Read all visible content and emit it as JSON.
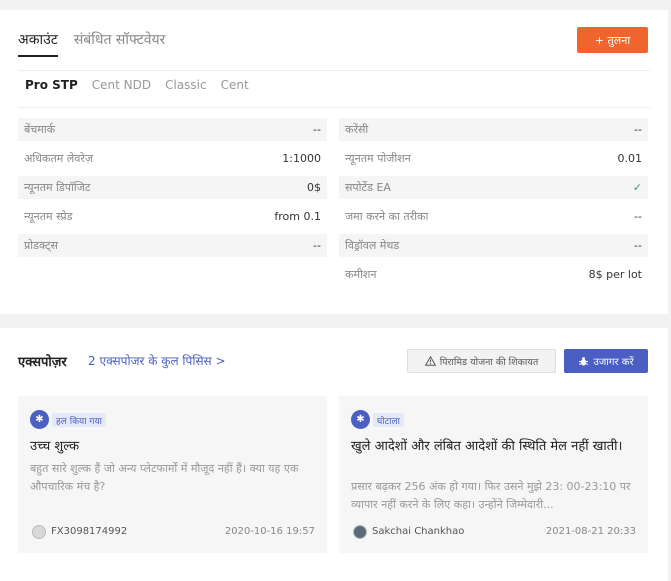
{
  "top_tabs": [
    "अकाउंट",
    "संबंधित सॉफ्टवेयर"
  ],
  "compare_label": "+ तुलना",
  "sub_tabs": [
    "Pro STP",
    "Cent NDD",
    "Classic",
    "Cent"
  ],
  "specs_left": [
    {
      "label": "बेंचमार्क",
      "value": "--"
    },
    {
      "label": "अधिकतम लेवरेज़",
      "value": "1:1000"
    },
    {
      "label": "न्यूनतम डिपॉजिट",
      "value": "0$"
    },
    {
      "label": "न्यूनतम स्प्रेड",
      "value": "from 0.1"
    },
    {
      "label": "प्रोडक्ट्स",
      "value": "--"
    }
  ],
  "specs_right": [
    {
      "label": "करेंसी",
      "value": "--"
    },
    {
      "label": "न्यूनतम पोजीशन",
      "value": "0.01"
    },
    {
      "label": "सपोर्टेड EA",
      "value": "✓"
    },
    {
      "label": "जमा करने का तरीका",
      "value": "--"
    },
    {
      "label": "विड्रॉवल मेथड",
      "value": "--"
    },
    {
      "label": "कमीशन",
      "value": "8$ per lot"
    }
  ],
  "exposure": {
    "title": "एक्सपोज़र",
    "count_link": "2 एक्सपोजर के कुल पिसिस >",
    "complaint_label": "पिरामिड योजना की शिकायत",
    "expose_label": "उजागर करें"
  },
  "posts": [
    {
      "badge": "हल किया गया",
      "title": "उच्च शुल्क",
      "body": "बहुत सारे शुल्क हैं जो अन्य प्लेटफार्मों में मौजूद नहीं हैं। क्या यह एक औपचारिक मंच है?",
      "user": "FX3098174992",
      "date": "2020-10-16 19:57"
    },
    {
      "badge": "घोटाला",
      "title": "खुले आदेशों और लंबित आदेशों की स्थिति मेल नहीं खाती।",
      "body": "प्रसार बढ़कर 256 अंक हो गया। फिर उसने मुझे 23: 00-23:10 पर व्यापार नहीं करने के लिए कहा। उन्होंने जिम्मेदारी...",
      "user": "Sakchai Chankhao",
      "date": "2021-08-21 20:33"
    }
  ]
}
